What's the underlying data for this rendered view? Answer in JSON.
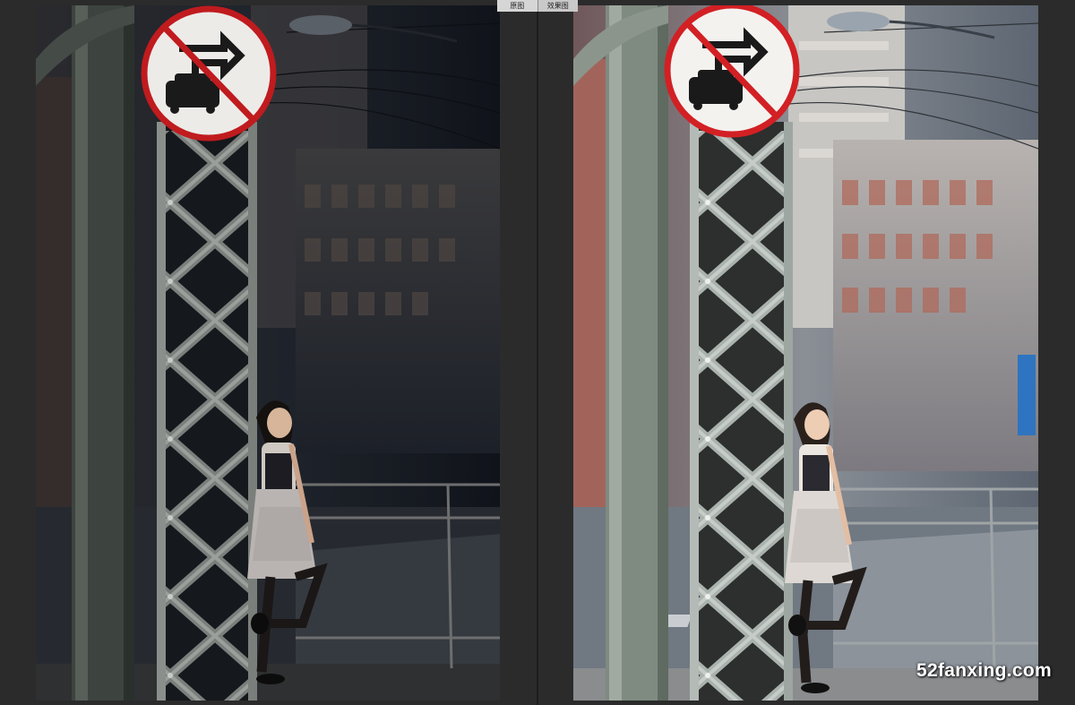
{
  "compare_labels": {
    "before": "原图",
    "after": "效果图"
  },
  "watermark": "52fanxing.com",
  "colors": {
    "sign_red": "#c81e1e",
    "steel": "#8d9694",
    "left_tone": "#1d2127",
    "right_tone": "#6a7078"
  }
}
